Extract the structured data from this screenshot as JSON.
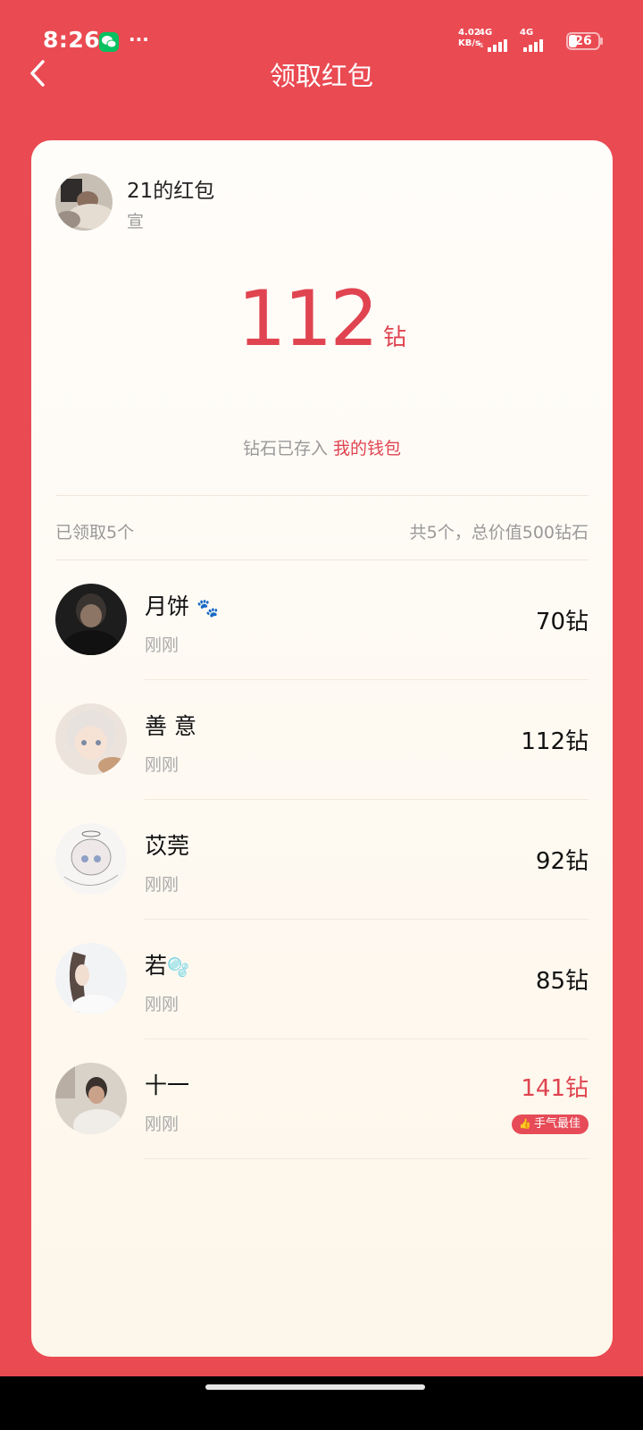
{
  "status_bar": {
    "time": "8:26",
    "more": "···",
    "net_speed_value": "4.02",
    "net_speed_unit": "KB/s",
    "sig1_label": "4G",
    "sig2_label": "4G",
    "battery": "26",
    "battery_level_percent": 26
  },
  "nav": {
    "title": "领取红包",
    "back_icon": "chevron-left-icon"
  },
  "envelope": {
    "owner_title": "21的红包",
    "owner_sub": "宣",
    "amount": "112",
    "unit": "钻",
    "stored_text": "钻石已存入",
    "wallet_link": "我的钱包"
  },
  "summary": {
    "claimed": "已领取5个",
    "total": "共5个，总价值500钻石"
  },
  "records": [
    {
      "name": "月饼",
      "time": "刚刚",
      "amount": "70钻",
      "emoji": "🐾",
      "best": false
    },
    {
      "name": "善 意",
      "time": "刚刚",
      "amount": "112钻",
      "emoji": "",
      "best": false
    },
    {
      "name": "苡莞",
      "time": "刚刚",
      "amount": "92钻",
      "emoji": "",
      "best": false
    },
    {
      "name": "若",
      "time": "刚刚",
      "amount": "85钻",
      "emoji": "🫧",
      "best": false
    },
    {
      "name": "十一",
      "time": "刚刚",
      "amount": "141钻",
      "emoji": "",
      "best": true,
      "badge": "手气最佳"
    }
  ],
  "colors": {
    "background": "#ea4a52",
    "accent": "#e04450",
    "card": "#fdf8ef"
  }
}
